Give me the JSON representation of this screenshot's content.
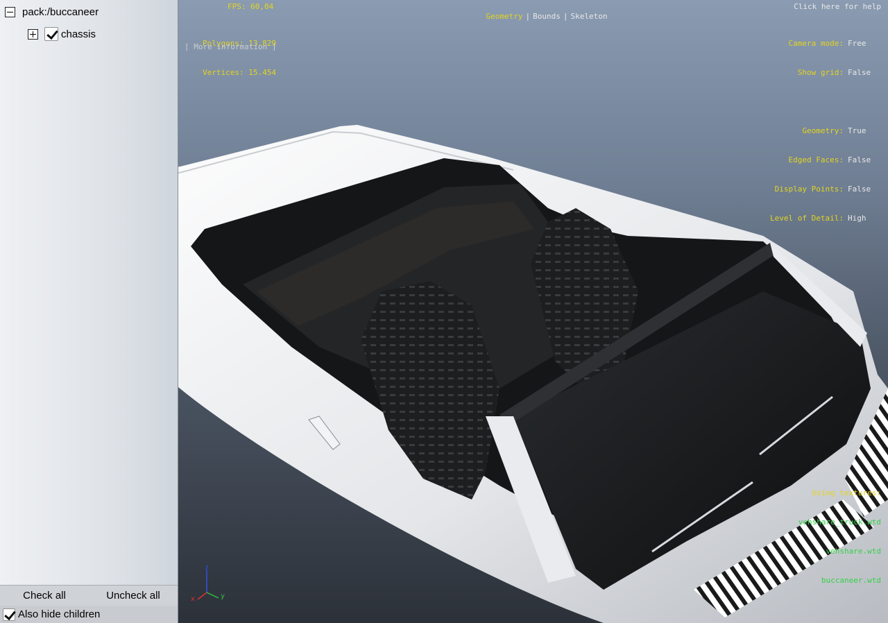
{
  "tree": {
    "root_label": "pack:/buccaneer",
    "child_label": "chassis"
  },
  "panel": {
    "check_all": "Check all",
    "uncheck_all": "Uncheck all",
    "also_hide_children": "Also hide children"
  },
  "viewport": {
    "fps_label": "FPS:",
    "fps_value": "60,04",
    "polygons_label": "Polygons:",
    "polygons_value": "13.829",
    "vertices_label": "Vertices:",
    "vertices_value": "15.454",
    "more_info": "[ More information ]",
    "tabs": [
      "Geometry",
      "Bounds",
      "Skeleton"
    ],
    "help": "Click here for help",
    "settings": [
      {
        "key": "Camera mode:",
        "value": "Free"
      },
      {
        "key": "Show grid:",
        "value": "False"
      },
      {
        "key": "Geometry:",
        "value": "True"
      },
      {
        "key": "Edged Faces:",
        "value": "False"
      },
      {
        "key": "Display Points:",
        "value": "False"
      },
      {
        "key": "Level of Detail:",
        "value": "High"
      }
    ],
    "textures_header": "Using textures:",
    "textures": [
      "vehshare_truck.wtd",
      "vehshare.wtd",
      "buccaneer.wtd"
    ],
    "axis": {
      "x": "x",
      "y": "y",
      "z": "z"
    }
  },
  "colors": {
    "overlay_yellow": "#e3d41f",
    "overlay_green": "#35d04a",
    "axis_x": "#e03030",
    "axis_y": "#30c040",
    "axis_z": "#3050e0"
  }
}
